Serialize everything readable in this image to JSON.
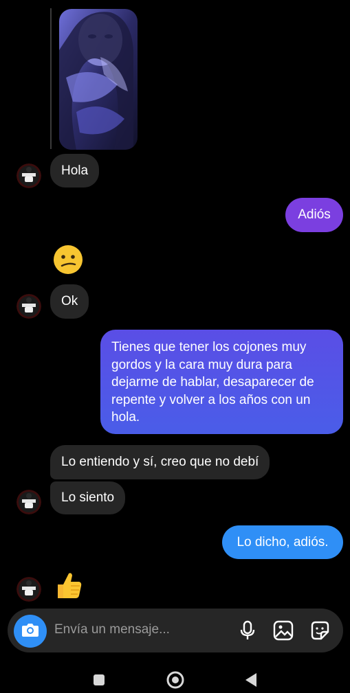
{
  "conversation": {
    "messages": [
      {
        "id": "m1",
        "sender": "other",
        "type": "image"
      },
      {
        "id": "m2",
        "sender": "other",
        "text": "Hola"
      },
      {
        "id": "m3",
        "sender": "me",
        "text": "Adiós"
      },
      {
        "id": "m4",
        "sender": "other",
        "type": "emoji",
        "emoji": "confused-face"
      },
      {
        "id": "m5",
        "sender": "other",
        "text": "Ok"
      },
      {
        "id": "m6",
        "sender": "me",
        "lines": [
          "Tienes que tener los cojones muy",
          "gordos y la cara muy dura para",
          "dejarme de hablar, desaparecer de",
          "repente y volver a los años con un",
          "hola."
        ]
      },
      {
        "id": "m7",
        "sender": "other",
        "text": "Lo entiendo y sí, creo que no debí"
      },
      {
        "id": "m8",
        "sender": "other",
        "text": "Lo siento"
      },
      {
        "id": "m9",
        "sender": "me",
        "text": "Lo dicho, adiós."
      },
      {
        "id": "m10",
        "sender": "other",
        "type": "emoji",
        "emoji": "thumbs-up"
      }
    ]
  },
  "composer": {
    "placeholder": "Envía un mensaje...",
    "icons": [
      "camera-icon",
      "microphone-icon",
      "gallery-icon",
      "sticker-icon"
    ]
  },
  "system_nav": {
    "icons": [
      "recents-icon",
      "home-icon",
      "back-icon"
    ]
  },
  "colors": {
    "background": "#000000",
    "incoming_bubble": "#262626",
    "outgoing_purple": "#7b3fe0",
    "outgoing_indigo": "#5456e6",
    "outgoing_blue": "#2f8ff6",
    "camera_button": "#2f8ff6"
  }
}
